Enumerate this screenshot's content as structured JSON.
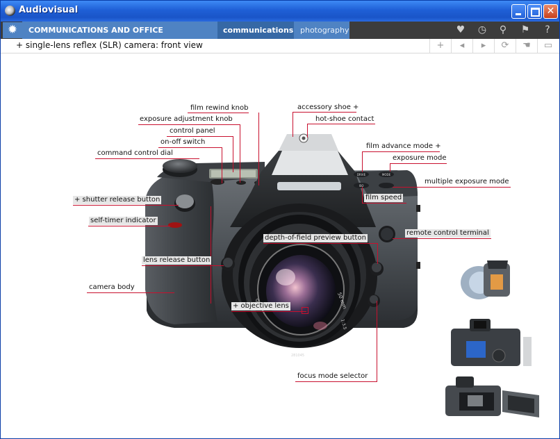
{
  "window": {
    "title": "Audiovisual"
  },
  "nav": {
    "section": "COMMUNICATIONS AND OFFICE AUTOMATION",
    "tab_active": "communications",
    "tab_other": "photography",
    "icons": [
      "favorite-heart-icon",
      "history-clock-icon",
      "search-icon",
      "flag-icon",
      "help-icon"
    ]
  },
  "toolbar": {
    "subject": "+ single-lens reflex (SLR) camera: front view"
  },
  "labels": {
    "film_rewind_knob": "film rewind knob",
    "accessory_shoe": "accessory shoe +",
    "exposure_adjustment_knob": "exposure adjustment knob",
    "hot_shoe_contact": "hot-shoe contact",
    "control_panel": "control panel",
    "on_off_switch": "on-off switch",
    "film_advance_mode": "film advance mode +",
    "command_control_dial": "command control dial",
    "exposure_mode": "exposure mode",
    "multiple_exposure_mode": "multiple exposure mode",
    "shutter_release_button": "+ shutter release button",
    "film_speed": "film speed",
    "self_timer_indicator": "self-timer indicator",
    "remote_control_terminal": "remote control terminal",
    "depth_of_field_preview_button": "depth-of-field preview button",
    "lens_release_button": "lens release button",
    "camera_body": "camera body",
    "objective_lens": "+ objective lens",
    "focus_mode_selector": "focus mode selector"
  },
  "lens_markings": {
    "focal": "50 mm",
    "aperture": "1:3.5",
    "serial": "281045",
    "brand": "AUTO"
  },
  "button_markings": {
    "drive": "DRIVE",
    "mode": "MODE",
    "iso": "ISO"
  },
  "colors": {
    "accent": "#c8102e",
    "nav_blue": "#4f83c3",
    "title_blue": "#1f5fd6"
  }
}
